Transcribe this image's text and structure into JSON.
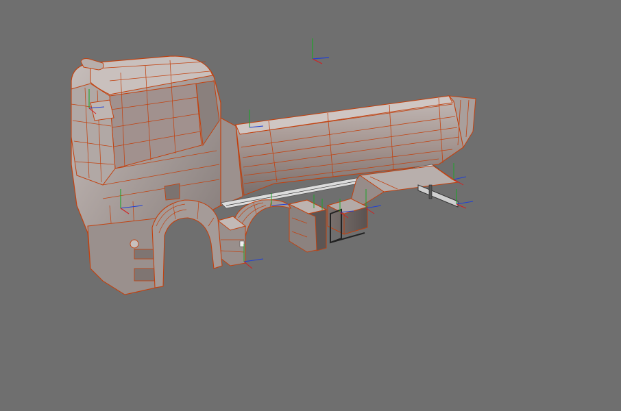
{
  "viewport": {
    "label": "",
    "background_color": "#6f6f6f",
    "model_fill_color": "#a9a09e",
    "model_shade_color": "#8a8280",
    "wire_color": "#c2410f",
    "axis_x_color": "#1f3fd6",
    "axis_y_color": "#1ea52a",
    "axis_z_color": "#d22020",
    "model": "dump-truck-wireframe",
    "view_mode": "shaded-with-wireframe"
  }
}
